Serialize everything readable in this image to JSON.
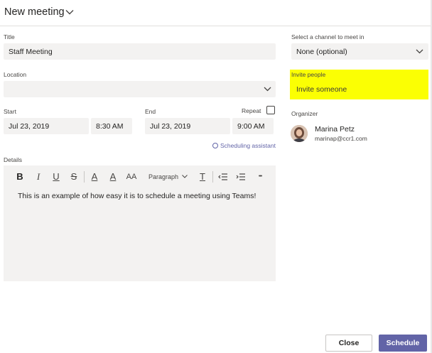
{
  "header": {
    "title": "New meeting"
  },
  "form": {
    "title_label": "Title",
    "title_value": "Staff Meeting",
    "location_label": "Location",
    "location_value": "",
    "start_label": "Start",
    "start_date": "Jul 23, 2019",
    "start_time": "8:30 AM",
    "end_label": "End",
    "end_date": "Jul 23, 2019",
    "end_time": "9:00 AM",
    "repeat_label": "Repeat",
    "repeat_checked": false,
    "scheduling_assistant": "Scheduling assistant",
    "details_label": "Details"
  },
  "editor": {
    "toolbar": {
      "bold": "B",
      "italic": "I",
      "underline": "U",
      "strikethrough": "S",
      "highlight": "A",
      "font_color": "A",
      "font_size": "AA",
      "paragraph": "Paragraph",
      "clear_format": "T",
      "more": "•••"
    },
    "body_text": "This is an example of how easy it is to schedule a meeting using Teams!"
  },
  "sidebar": {
    "channel_label": "Select a channel to meet in",
    "channel_value": "None (optional)",
    "invite_label": "Invite people",
    "invite_placeholder": "Invite someone",
    "organizer_label": "Organizer",
    "organizer_name": "Marina Petz",
    "organizer_email": "marinap@ccr1.com"
  },
  "footer": {
    "close_label": "Close",
    "schedule_label": "Schedule"
  },
  "colors": {
    "accent": "#6264a7",
    "highlight": "#fbff03",
    "field_bg": "#f3f2f1"
  }
}
